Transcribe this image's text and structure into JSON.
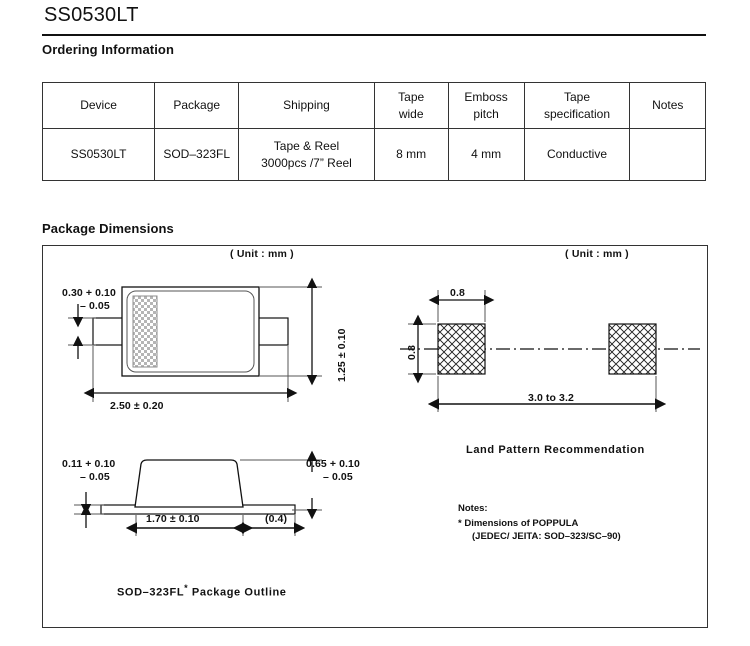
{
  "document": {
    "title": "SS0530LT"
  },
  "ordering": {
    "heading": "Ordering Information",
    "columns": [
      "Device",
      "Package",
      "Shipping",
      "Tape\nwide",
      "Emboss\npitch",
      "Tape\nspecification",
      "Notes"
    ],
    "columns_lines": [
      [
        "Device"
      ],
      [
        "Package"
      ],
      [
        "Shipping"
      ],
      [
        "Tape",
        "wide"
      ],
      [
        "Emboss",
        "pitch"
      ],
      [
        "Tape",
        "specification"
      ],
      [
        "Notes"
      ]
    ],
    "rows": [
      {
        "device": "SS0530LT",
        "package": "SOD–323FL",
        "shipping_line1": "Tape & Reel",
        "shipping_line2": "3000pcs /7” Reel",
        "tape_wide": "8 mm",
        "emboss_pitch": "4 mm",
        "tape_specification": "Conductive",
        "notes": ""
      }
    ]
  },
  "package_dimensions": {
    "heading": "Package Dimensions",
    "unit_label_left": "( Unit : mm )",
    "unit_label_right": "( Unit : mm )",
    "top_view": {
      "dim_lead_width_line1": "0.30 + 0.10",
      "dim_lead_width_line2": "– 0.05",
      "dim_body_height": "1.25 ± 0.10",
      "dim_total_length": "2.50 ± 0.20"
    },
    "side_view": {
      "dim_lead_thickness_line1": "0.11 + 0.10",
      "dim_lead_thickness_line2": "– 0.05",
      "dim_body_height_line1": "0.65 + 0.10",
      "dim_body_height_line2": "– 0.05",
      "dim_body_length": "1.70 ± 0.10",
      "dim_lead_length": "(0.4)",
      "caption": "SOD–323FL",
      "caption_superscript": "*",
      "caption_tail": " Package Outline"
    },
    "land_pattern": {
      "dim_pad_width": "0.8",
      "dim_pad_height": "0.8",
      "dim_span": "3.0 to 3.2",
      "caption": "Land Pattern Recommendation"
    },
    "notes": {
      "label": "Notes:",
      "line1_mark": "*",
      "line1": "Dimensions of POPPULA",
      "line2": "(JEDEC/ JEITA: SOD–323/SC–90)"
    }
  },
  "colors": {
    "ink": "#111111",
    "rule": "#333333",
    "hatch": "#9a9a9a"
  }
}
